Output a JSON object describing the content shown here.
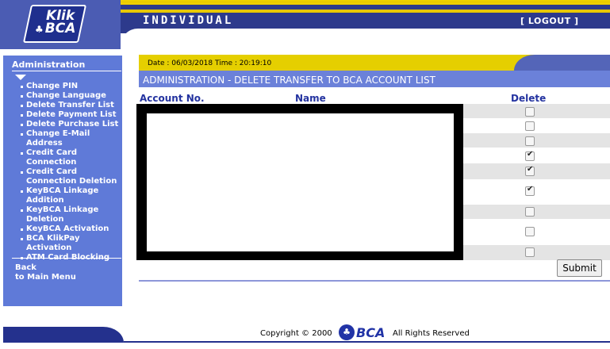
{
  "header": {
    "logo_line1": "Klik",
    "logo_line2": "BCA",
    "mode": "INDIVIDUAL",
    "logout_label": "[ LOGOUT ]"
  },
  "sidebar": {
    "title": "Administration",
    "items": [
      "Change PIN",
      "Change Language",
      "Delete Transfer List",
      "Delete Payment List",
      "Delete Purchase List",
      "Change E-Mail Address",
      "Credit Card Connection",
      "Credit Card Connection Deletion",
      "KeyBCA Linkage Addition",
      "KeyBCA Linkage Deletion",
      "KeyBCA Activation",
      "BCA KlikPay Activation",
      "ATM Card Blocking"
    ],
    "back_line1": "Back",
    "back_line2": "to Main Menu"
  },
  "content": {
    "datetime": "Date : 06/03/2018 Time : 20:19:10",
    "title": "ADMINISTRATION - DELETE TRANSFER TO BCA ACCOUNT LIST",
    "columns": {
      "account": "Account No.",
      "name": "Name",
      "delete": "Delete"
    },
    "rows_checked": [
      false,
      false,
      false,
      true,
      true,
      true,
      false,
      false,
      false
    ],
    "submit_label": "Submit"
  },
  "footer": {
    "copyright": "Copyright © 2000",
    "logo_text": "BCA",
    "rights": "All Rights Reserved"
  },
  "colors": {
    "navy": "#2d3a8c",
    "sidebar_blue": "#5f7ad8",
    "title_blue": "#6b81d9",
    "yellow": "#e5cf00",
    "header_text": "#2433a0"
  }
}
